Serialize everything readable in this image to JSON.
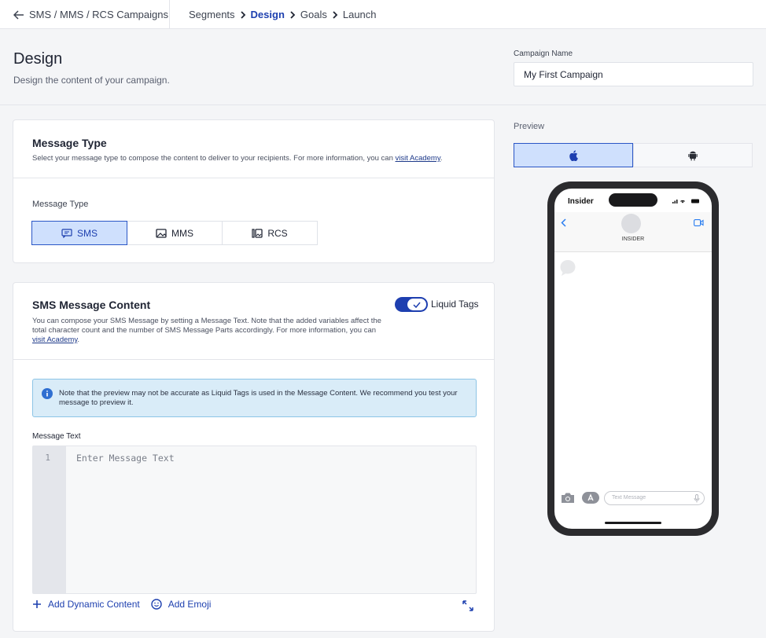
{
  "topbar": {
    "back_label": "SMS / MMS / RCS Campaigns",
    "steps": [
      "Segments",
      "Design",
      "Goals",
      "Launch"
    ],
    "active_step": "Design"
  },
  "header": {
    "title": "Design",
    "subtitle": "Design the content of your campaign.",
    "campaign_name_label": "Campaign Name",
    "campaign_name_value": "My First Campaign"
  },
  "message_type_card": {
    "title": "Message Type",
    "desc_prefix": "Select your message type to compose the content to deliver to your recipients. For more information, you can ",
    "desc_link": "visit Academy",
    "desc_suffix": ".",
    "type_label": "Message Type",
    "options": [
      "SMS",
      "MMS",
      "RCS"
    ],
    "selected": "SMS"
  },
  "sms_content_card": {
    "title": "SMS Message Content",
    "toggle_label": "Liquid Tags",
    "toggle_on": true,
    "desc_prefix": "You can compose your SMS Message by setting a Message Text. Note that the added variables affect the total character count and the number of SMS Message Parts accordingly. For more information, you can ",
    "desc_link": "visit Academy",
    "desc_suffix": ".",
    "notice": "Note that the preview may not be accurate as Liquid Tags is used in the Message Content. We recommend you test your message to preview it.",
    "message_text_label": "Message Text",
    "line_number": "1",
    "placeholder": "Enter Message Text",
    "add_dynamic": "Add Dynamic Content",
    "add_emoji": "Add Emoji"
  },
  "preview": {
    "label": "Preview",
    "os_options": [
      "apple-icon",
      "android-icon"
    ],
    "selected_os": "apple-icon",
    "carrier": "Insider",
    "contact": "INSIDER",
    "input_placeholder": "Text Message"
  },
  "colors": {
    "accent": "#1e40af",
    "selected_bg": "#cfe0fd",
    "toggle": "#1e3fb0",
    "notice_bg": "#d9ecf8"
  }
}
